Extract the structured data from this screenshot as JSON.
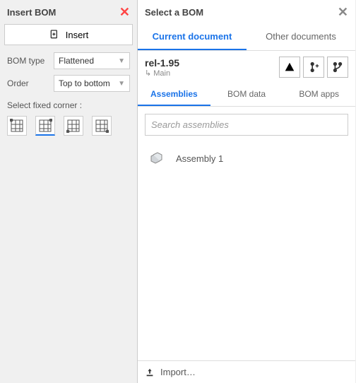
{
  "left": {
    "title": "Insert BOM",
    "insert_label": "Insert",
    "bom_type_label": "BOM type",
    "bom_type_value": "Flattened",
    "order_label": "Order",
    "order_value": "Top to bottom",
    "fixed_corner_label": "Select fixed corner :"
  },
  "right": {
    "title": "Select a BOM",
    "tabs_top": {
      "current": "Current document",
      "other": "Other documents"
    },
    "doc": {
      "name": "rel-1.95",
      "sub": "↳ Main"
    },
    "tabs_sub": {
      "assemblies": "Assemblies",
      "bom_data": "BOM data",
      "bom_apps": "BOM apps"
    },
    "search_placeholder": "Search assemblies",
    "assembly": {
      "item1": "Assembly 1"
    },
    "import_label": "Import…"
  }
}
